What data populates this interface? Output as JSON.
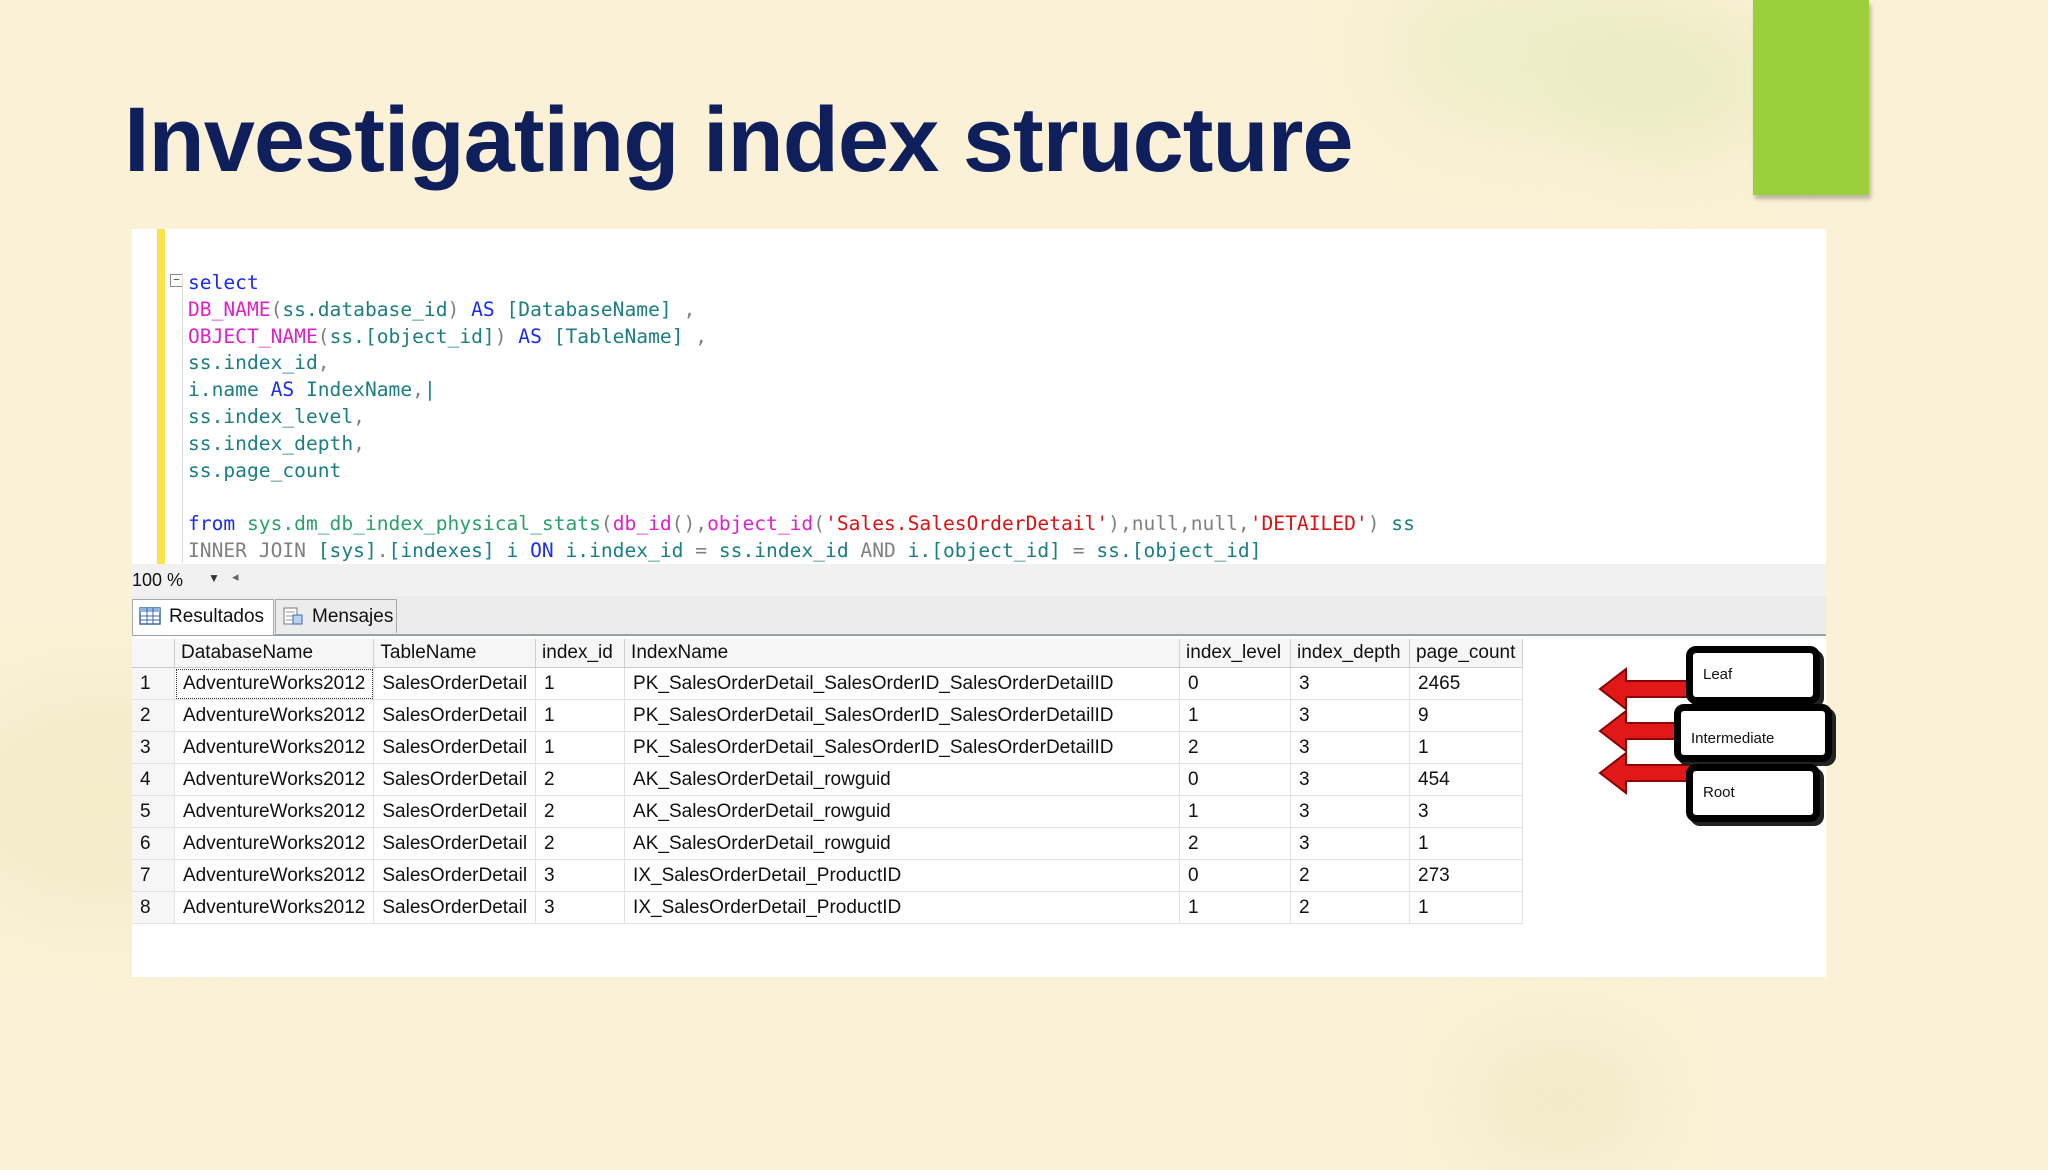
{
  "slide": {
    "title": "Investigating index structure",
    "colors": {
      "background": "#fbf1d6",
      "title": "#0f1f5c",
      "accent": "#9bd03c"
    }
  },
  "editor": {
    "lines": [
      [
        {
          "t": "select",
          "c": "kw"
        }
      ],
      [
        {
          "t": "DB_NAME",
          "c": "fn"
        },
        {
          "t": "(",
          "c": "gray"
        },
        {
          "t": "ss.database_id",
          "c": "id"
        },
        {
          "t": ")",
          "c": "gray"
        },
        {
          "t": " AS ",
          "c": "kw"
        },
        {
          "t": "[DatabaseName]",
          "c": "id"
        },
        {
          "t": " ,",
          "c": "gray"
        }
      ],
      [
        {
          "t": "OBJECT_NAME",
          "c": "fn"
        },
        {
          "t": "(",
          "c": "gray"
        },
        {
          "t": "ss.[object_id]",
          "c": "id"
        },
        {
          "t": ")",
          "c": "gray"
        },
        {
          "t": " AS ",
          "c": "kw"
        },
        {
          "t": "[TableName]",
          "c": "id"
        },
        {
          "t": " ,",
          "c": "gray"
        }
      ],
      [
        {
          "t": "ss.index_id",
          "c": "id"
        },
        {
          "t": ",",
          "c": "gray"
        }
      ],
      [
        {
          "t": "i.name",
          "c": "id"
        },
        {
          "t": " AS ",
          "c": "kw"
        },
        {
          "t": "IndexName",
          "c": "id"
        },
        {
          "t": ",",
          "c": "gray"
        },
        {
          "t": "|",
          "c": "id"
        }
      ],
      [
        {
          "t": "ss.index_level",
          "c": "id"
        },
        {
          "t": ",",
          "c": "gray"
        }
      ],
      [
        {
          "t": "ss.index_depth",
          "c": "id"
        },
        {
          "t": ",",
          "c": "gray"
        }
      ],
      [
        {
          "t": "ss.page_count",
          "c": "id"
        }
      ],
      [
        {
          "t": "",
          "c": "id"
        }
      ],
      [
        {
          "t": "from ",
          "c": "kw"
        },
        {
          "t": "sys.dm_db_index_physical_stats",
          "c": "sys"
        },
        {
          "t": "(",
          "c": "gray"
        },
        {
          "t": "db_id",
          "c": "fn"
        },
        {
          "t": "(),",
          "c": "gray"
        },
        {
          "t": "object_id",
          "c": "fn"
        },
        {
          "t": "(",
          "c": "gray"
        },
        {
          "t": "'Sales.SalesOrderDetail'",
          "c": "str"
        },
        {
          "t": "),null,null,",
          "c": "gray"
        },
        {
          "t": "'DETAILED'",
          "c": "str"
        },
        {
          "t": ")",
          "c": "gray"
        },
        {
          "t": " ss",
          "c": "id"
        }
      ],
      [
        {
          "t": "INNER JOIN ",
          "c": "gray"
        },
        {
          "t": "[sys]",
          "c": "id"
        },
        {
          "t": ".",
          "c": "gray"
        },
        {
          "t": "[indexes]",
          "c": "id"
        },
        {
          "t": " i ",
          "c": "id"
        },
        {
          "t": "ON ",
          "c": "kw"
        },
        {
          "t": "i.index_id",
          "c": "id"
        },
        {
          "t": " = ",
          "c": "gray"
        },
        {
          "t": "ss.index_id",
          "c": "id"
        },
        {
          "t": " AND ",
          "c": "gray"
        },
        {
          "t": "i.[object_id]",
          "c": "id"
        },
        {
          "t": " = ",
          "c": "gray"
        },
        {
          "t": "ss.[object_id]",
          "c": "id"
        }
      ]
    ]
  },
  "zoom": {
    "value": "100 %"
  },
  "tabs": [
    {
      "label": "Resultados",
      "icon": "grid-icon",
      "active": true
    },
    {
      "label": "Mensajes",
      "icon": "messages-icon",
      "active": false
    }
  ],
  "results": {
    "columns": [
      "",
      "DatabaseName",
      "TableName",
      "index_id",
      "IndexName",
      "index_level",
      "index_depth",
      "page_count"
    ],
    "rows": [
      [
        "1",
        "AdventureWorks2012",
        "SalesOrderDetail",
        "1",
        "PK_SalesOrderDetail_SalesOrderID_SalesOrderDetailID",
        "0",
        "3",
        "2465"
      ],
      [
        "2",
        "AdventureWorks2012",
        "SalesOrderDetail",
        "1",
        "PK_SalesOrderDetail_SalesOrderID_SalesOrderDetailID",
        "1",
        "3",
        "9"
      ],
      [
        "3",
        "AdventureWorks2012",
        "SalesOrderDetail",
        "1",
        "PK_SalesOrderDetail_SalesOrderID_SalesOrderDetailID",
        "2",
        "3",
        "1"
      ],
      [
        "4",
        "AdventureWorks2012",
        "SalesOrderDetail",
        "2",
        "AK_SalesOrderDetail_rowguid",
        "0",
        "3",
        "454"
      ],
      [
        "5",
        "AdventureWorks2012",
        "SalesOrderDetail",
        "2",
        "AK_SalesOrderDetail_rowguid",
        "1",
        "3",
        "3"
      ],
      [
        "6",
        "AdventureWorks2012",
        "SalesOrderDetail",
        "2",
        "AK_SalesOrderDetail_rowguid",
        "2",
        "3",
        "1"
      ],
      [
        "7",
        "AdventureWorks2012",
        "SalesOrderDetail",
        "3",
        "IX_SalesOrderDetail_ProductID",
        "0",
        "2",
        "273"
      ],
      [
        "8",
        "AdventureWorks2012",
        "SalesOrderDetail",
        "3",
        "IX_SalesOrderDetail_ProductID",
        "1",
        "2",
        "1"
      ]
    ]
  },
  "annotations": {
    "labels": [
      "Leaf",
      "Intermediate",
      "Root"
    ],
    "arrow_color": "#e01818"
  }
}
